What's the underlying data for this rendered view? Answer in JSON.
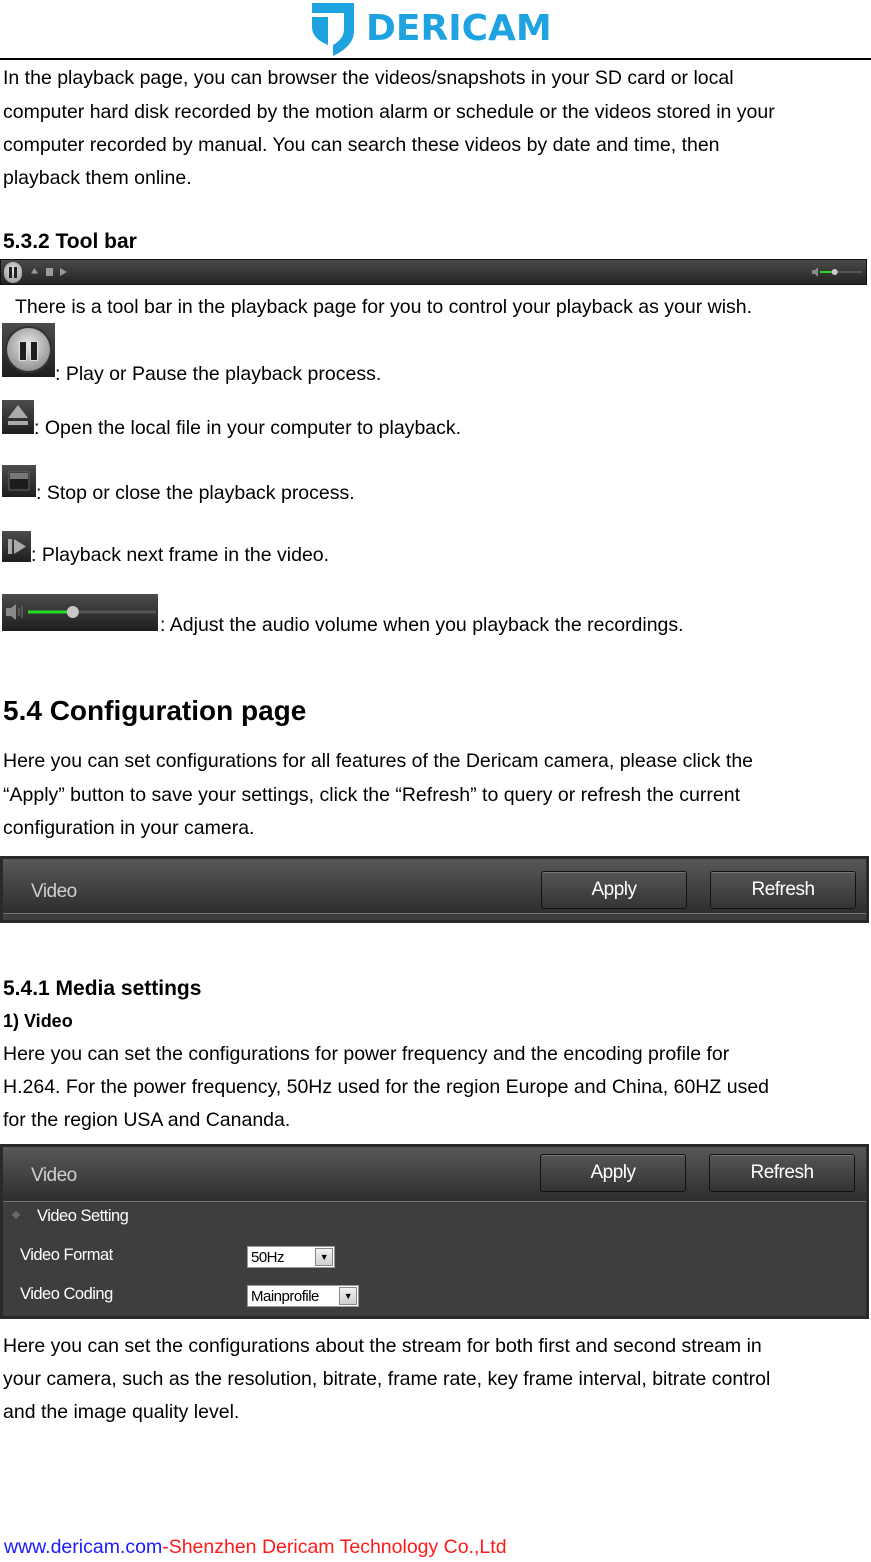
{
  "header": {
    "brand": "DERICAM",
    "brand_color": "#1ea3e0"
  },
  "intro": {
    "lines": [
      "In the playback page, you can browser the videos/snapshots in your SD card or local",
      "computer hard disk recorded by the motion alarm or schedule or the videos stored in your",
      "computer recorded by manual. You can search these videos by date and time, then",
      "playback them online."
    ]
  },
  "toolbar_section": {
    "heading": "5.3.2 Tool bar",
    "toolbar_icons": [
      "pause-icon",
      "eject-icon",
      "stop-icon",
      "next-frame-icon",
      "volume-icon"
    ],
    "description": "There is a tool bar in the playback page for you to control your playback as your wish.",
    "items": [
      {
        "icon": "pause-icon",
        "text": ": Play or Pause the playback process."
      },
      {
        "icon": "eject-icon",
        "text": ": Open the local file in your computer to playback."
      },
      {
        "icon": "stop-icon",
        "text": ": Stop or close the playback process."
      },
      {
        "icon": "next-frame-icon",
        "text": ": Playback next frame in the video."
      },
      {
        "icon": "volume-slider",
        "text": ": Adjust the audio volume when you playback the recordings."
      }
    ],
    "volume_level": 0.35,
    "volume_color": "#22dd22"
  },
  "config_section": {
    "heading": "5.4 Configuration page",
    "lines": [
      "Here you can set configurations for all features of the Dericam camera, please click the",
      "“Apply” button to save your settings, click the “Refresh” to query or refresh the current",
      "configuration in your camera."
    ],
    "panel": {
      "title": "Video",
      "apply_label": "Apply",
      "refresh_label": "Refresh"
    }
  },
  "media_section": {
    "heading": "5.4.1 Media settings",
    "subheading": "1) Video",
    "lines": [
      "Here you can set the configurations for power frequency and the encoding profile for",
      "H.264. For the power frequency, 50Hz used for the region Europe and China, 60HZ used",
      "for the region USA and Cananda."
    ],
    "panel": {
      "title": "Video",
      "apply_label": "Apply",
      "refresh_label": "Refresh",
      "group_label": "Video Setting",
      "fields": [
        {
          "label": "Video Format",
          "value": "50Hz"
        },
        {
          "label": "Video Coding",
          "value": "Mainprofile"
        }
      ]
    },
    "after_lines": [
      "Here you can set the configurations about the stream for both first and second stream in",
      "your camera, such as the resolution, bitrate, frame rate, key frame interval, bitrate control",
      "and the image quality level."
    ]
  },
  "footer": {
    "website": "www.dericam.com",
    "separator": "-",
    "company": "Shenzhen Dericam Technology Co.,Ltd",
    "website_color": "#1a1aff",
    "company_color": "#ff1a1a"
  }
}
